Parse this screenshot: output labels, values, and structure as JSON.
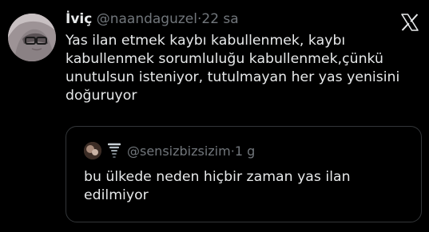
{
  "tweet": {
    "display_name": "İviç",
    "handle": "@naandaguzel",
    "separator": "·",
    "time": "22 sa",
    "text": "Yas ilan etmek kaybı kabullenmek, kaybı\nkabullenmek sorumluluğu kabullenmek,çünkü\nunutulsun isteniyor, tutulmayan her yas yenisini\ndoğuruyor"
  },
  "quoted_tweet": {
    "handle": "@sensizbizsizim",
    "separator": "·",
    "time": "1 g",
    "text": "bu ülkede neden hiçbir zaman yas ilan\nedilmiyor"
  },
  "icons": {
    "brand": "x-logo-icon",
    "quote_emoji": "tornado-icon"
  },
  "colors": {
    "background": "#000000",
    "text_primary": "#e7e9ea",
    "text_secondary": "#71767b",
    "border": "#333639"
  }
}
